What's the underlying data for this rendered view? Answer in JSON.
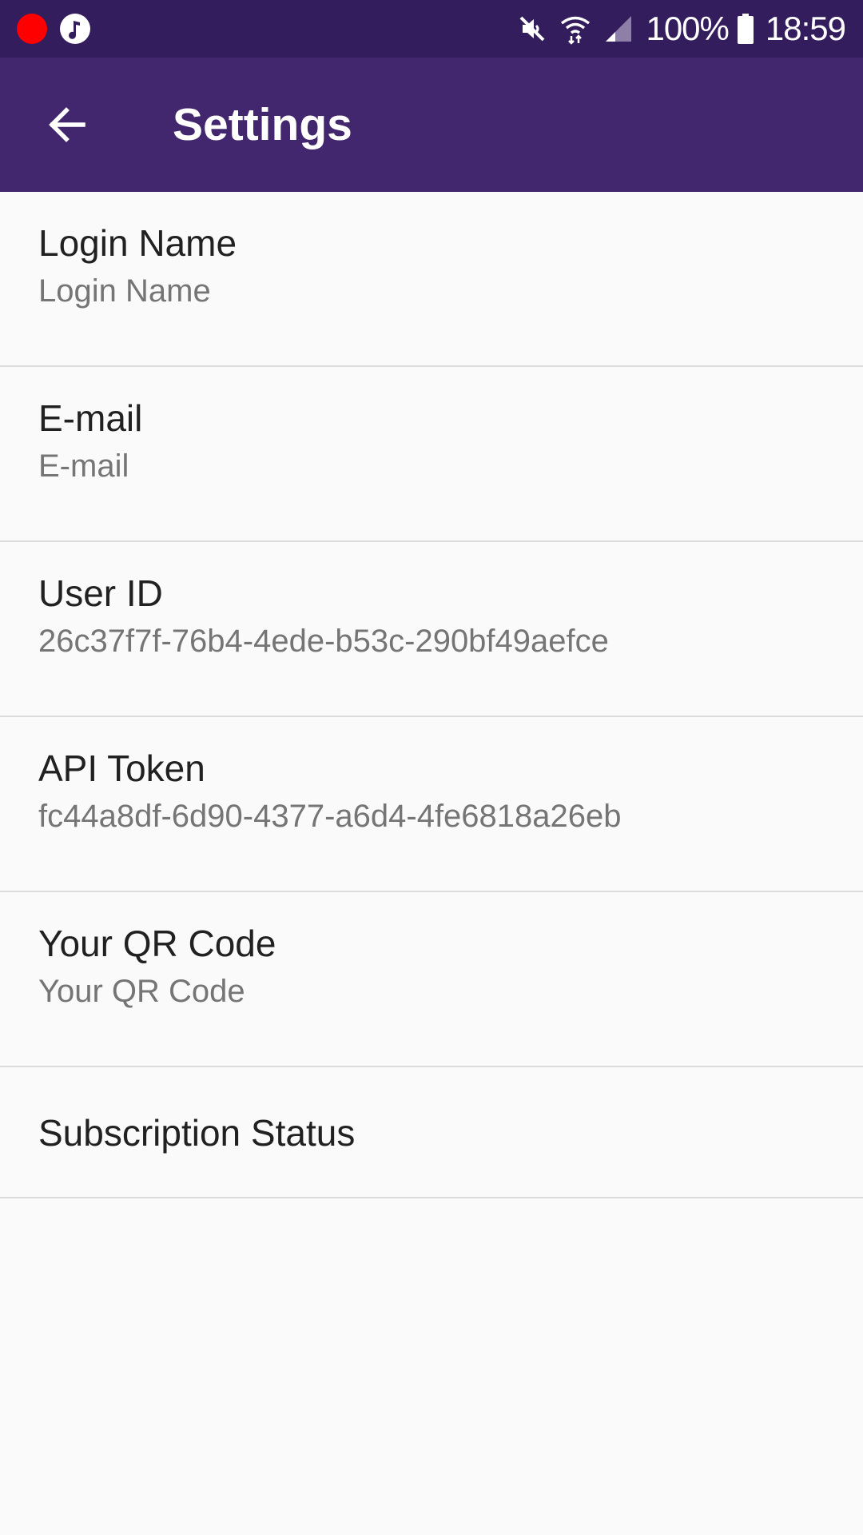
{
  "status_bar": {
    "battery_percent": "100%",
    "time": "18:59",
    "background_color": "#331d5c",
    "recording_dot_color": "#ff0000",
    "icons": [
      "recording-dot",
      "music-note-icon",
      "mute-icon",
      "wifi-icon",
      "signal-icon",
      "battery-icon"
    ]
  },
  "app_bar": {
    "title": "Settings",
    "background_color": "#42276f",
    "back_icon": "arrow-left-icon"
  },
  "settings": {
    "items": [
      {
        "title": "Login Name",
        "summary": "Login Name"
      },
      {
        "title": "E-mail",
        "summary": "E-mail"
      },
      {
        "title": "User ID",
        "summary": "26c37f7f-76b4-4ede-b53c-290bf49aefce"
      },
      {
        "title": "API Token",
        "summary": "fc44a8df-6d90-4377-a6d4-4fe6818a26eb"
      },
      {
        "title": "Your QR Code",
        "summary": "Your QR Code"
      },
      {
        "title": "Subscription Status"
      }
    ]
  }
}
